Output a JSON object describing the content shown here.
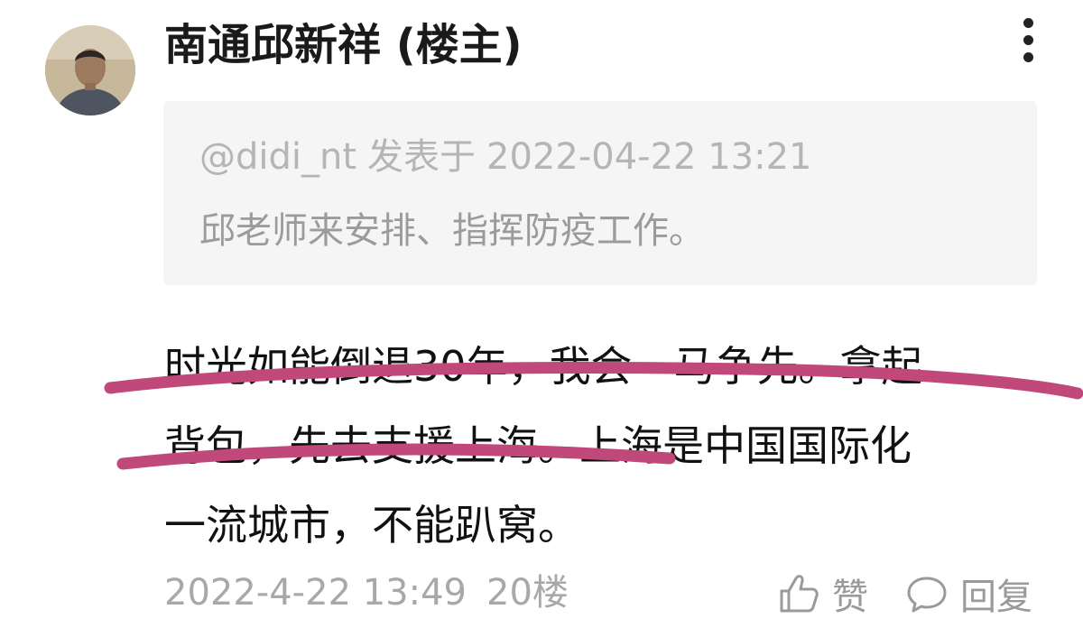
{
  "post": {
    "author": "南通邱新祥",
    "author_tag": "(楼主)",
    "quote": {
      "mention": "@didi_nt",
      "posted_on": "发表于",
      "datetime": "2022-04-22 13:21",
      "text": "邱老师来安排、指挥防疫工作。"
    },
    "content_lines": [
      "时光如能倒退30年，我会一马争先。拿起",
      "背包，先去支援上海。上海是中国国际化",
      "一流城市，不能趴窝。"
    ],
    "timestamp": "2022-4-22 13:49",
    "floor": "20楼",
    "actions": {
      "like_label": "赞",
      "reply_label": "回复"
    },
    "icons": {
      "more": "more-vertical-icon",
      "like": "thumbs-up-icon",
      "reply": "comment-bubble-icon"
    },
    "colors": {
      "marker_underline": "#c0487a",
      "quote_background": "#f5f5f5"
    }
  }
}
